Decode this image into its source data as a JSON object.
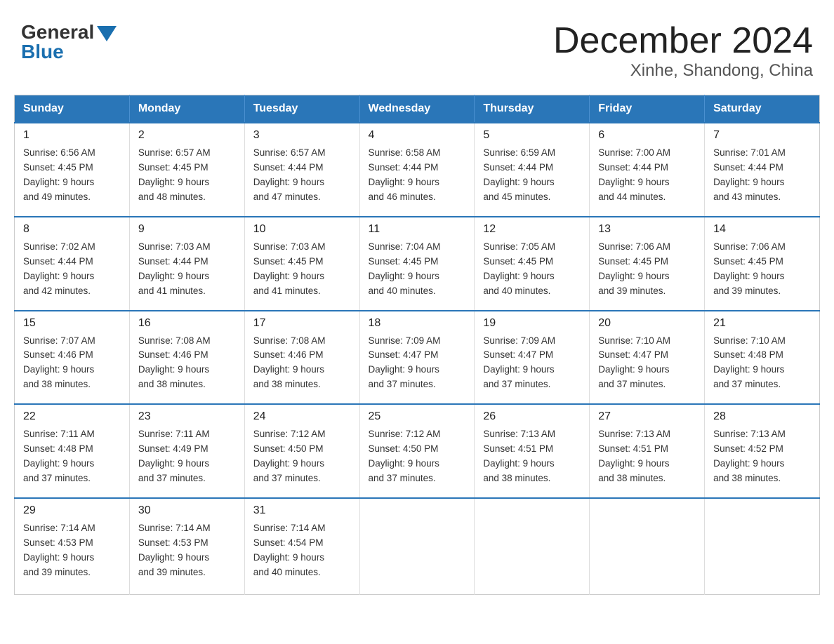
{
  "header": {
    "logo": {
      "general": "General",
      "blue": "Blue"
    },
    "title": "December 2024",
    "subtitle": "Xinhe, Shandong, China"
  },
  "days_of_week": [
    "Sunday",
    "Monday",
    "Tuesday",
    "Wednesday",
    "Thursday",
    "Friday",
    "Saturday"
  ],
  "weeks": [
    [
      {
        "day": "1",
        "sunrise": "Sunrise: 6:56 AM",
        "sunset": "Sunset: 4:45 PM",
        "daylight": "Daylight: 9 hours",
        "daylight2": "and 49 minutes."
      },
      {
        "day": "2",
        "sunrise": "Sunrise: 6:57 AM",
        "sunset": "Sunset: 4:45 PM",
        "daylight": "Daylight: 9 hours",
        "daylight2": "and 48 minutes."
      },
      {
        "day": "3",
        "sunrise": "Sunrise: 6:57 AM",
        "sunset": "Sunset: 4:44 PM",
        "daylight": "Daylight: 9 hours",
        "daylight2": "and 47 minutes."
      },
      {
        "day": "4",
        "sunrise": "Sunrise: 6:58 AM",
        "sunset": "Sunset: 4:44 PM",
        "daylight": "Daylight: 9 hours",
        "daylight2": "and 46 minutes."
      },
      {
        "day": "5",
        "sunrise": "Sunrise: 6:59 AM",
        "sunset": "Sunset: 4:44 PM",
        "daylight": "Daylight: 9 hours",
        "daylight2": "and 45 minutes."
      },
      {
        "day": "6",
        "sunrise": "Sunrise: 7:00 AM",
        "sunset": "Sunset: 4:44 PM",
        "daylight": "Daylight: 9 hours",
        "daylight2": "and 44 minutes."
      },
      {
        "day": "7",
        "sunrise": "Sunrise: 7:01 AM",
        "sunset": "Sunset: 4:44 PM",
        "daylight": "Daylight: 9 hours",
        "daylight2": "and 43 minutes."
      }
    ],
    [
      {
        "day": "8",
        "sunrise": "Sunrise: 7:02 AM",
        "sunset": "Sunset: 4:44 PM",
        "daylight": "Daylight: 9 hours",
        "daylight2": "and 42 minutes."
      },
      {
        "day": "9",
        "sunrise": "Sunrise: 7:03 AM",
        "sunset": "Sunset: 4:44 PM",
        "daylight": "Daylight: 9 hours",
        "daylight2": "and 41 minutes."
      },
      {
        "day": "10",
        "sunrise": "Sunrise: 7:03 AM",
        "sunset": "Sunset: 4:45 PM",
        "daylight": "Daylight: 9 hours",
        "daylight2": "and 41 minutes."
      },
      {
        "day": "11",
        "sunrise": "Sunrise: 7:04 AM",
        "sunset": "Sunset: 4:45 PM",
        "daylight": "Daylight: 9 hours",
        "daylight2": "and 40 minutes."
      },
      {
        "day": "12",
        "sunrise": "Sunrise: 7:05 AM",
        "sunset": "Sunset: 4:45 PM",
        "daylight": "Daylight: 9 hours",
        "daylight2": "and 40 minutes."
      },
      {
        "day": "13",
        "sunrise": "Sunrise: 7:06 AM",
        "sunset": "Sunset: 4:45 PM",
        "daylight": "Daylight: 9 hours",
        "daylight2": "and 39 minutes."
      },
      {
        "day": "14",
        "sunrise": "Sunrise: 7:06 AM",
        "sunset": "Sunset: 4:45 PM",
        "daylight": "Daylight: 9 hours",
        "daylight2": "and 39 minutes."
      }
    ],
    [
      {
        "day": "15",
        "sunrise": "Sunrise: 7:07 AM",
        "sunset": "Sunset: 4:46 PM",
        "daylight": "Daylight: 9 hours",
        "daylight2": "and 38 minutes."
      },
      {
        "day": "16",
        "sunrise": "Sunrise: 7:08 AM",
        "sunset": "Sunset: 4:46 PM",
        "daylight": "Daylight: 9 hours",
        "daylight2": "and 38 minutes."
      },
      {
        "day": "17",
        "sunrise": "Sunrise: 7:08 AM",
        "sunset": "Sunset: 4:46 PM",
        "daylight": "Daylight: 9 hours",
        "daylight2": "and 38 minutes."
      },
      {
        "day": "18",
        "sunrise": "Sunrise: 7:09 AM",
        "sunset": "Sunset: 4:47 PM",
        "daylight": "Daylight: 9 hours",
        "daylight2": "and 37 minutes."
      },
      {
        "day": "19",
        "sunrise": "Sunrise: 7:09 AM",
        "sunset": "Sunset: 4:47 PM",
        "daylight": "Daylight: 9 hours",
        "daylight2": "and 37 minutes."
      },
      {
        "day": "20",
        "sunrise": "Sunrise: 7:10 AM",
        "sunset": "Sunset: 4:47 PM",
        "daylight": "Daylight: 9 hours",
        "daylight2": "and 37 minutes."
      },
      {
        "day": "21",
        "sunrise": "Sunrise: 7:10 AM",
        "sunset": "Sunset: 4:48 PM",
        "daylight": "Daylight: 9 hours",
        "daylight2": "and 37 minutes."
      }
    ],
    [
      {
        "day": "22",
        "sunrise": "Sunrise: 7:11 AM",
        "sunset": "Sunset: 4:48 PM",
        "daylight": "Daylight: 9 hours",
        "daylight2": "and 37 minutes."
      },
      {
        "day": "23",
        "sunrise": "Sunrise: 7:11 AM",
        "sunset": "Sunset: 4:49 PM",
        "daylight": "Daylight: 9 hours",
        "daylight2": "and 37 minutes."
      },
      {
        "day": "24",
        "sunrise": "Sunrise: 7:12 AM",
        "sunset": "Sunset: 4:50 PM",
        "daylight": "Daylight: 9 hours",
        "daylight2": "and 37 minutes."
      },
      {
        "day": "25",
        "sunrise": "Sunrise: 7:12 AM",
        "sunset": "Sunset: 4:50 PM",
        "daylight": "Daylight: 9 hours",
        "daylight2": "and 37 minutes."
      },
      {
        "day": "26",
        "sunrise": "Sunrise: 7:13 AM",
        "sunset": "Sunset: 4:51 PM",
        "daylight": "Daylight: 9 hours",
        "daylight2": "and 38 minutes."
      },
      {
        "day": "27",
        "sunrise": "Sunrise: 7:13 AM",
        "sunset": "Sunset: 4:51 PM",
        "daylight": "Daylight: 9 hours",
        "daylight2": "and 38 minutes."
      },
      {
        "day": "28",
        "sunrise": "Sunrise: 7:13 AM",
        "sunset": "Sunset: 4:52 PM",
        "daylight": "Daylight: 9 hours",
        "daylight2": "and 38 minutes."
      }
    ],
    [
      {
        "day": "29",
        "sunrise": "Sunrise: 7:14 AM",
        "sunset": "Sunset: 4:53 PM",
        "daylight": "Daylight: 9 hours",
        "daylight2": "and 39 minutes."
      },
      {
        "day": "30",
        "sunrise": "Sunrise: 7:14 AM",
        "sunset": "Sunset: 4:53 PM",
        "daylight": "Daylight: 9 hours",
        "daylight2": "and 39 minutes."
      },
      {
        "day": "31",
        "sunrise": "Sunrise: 7:14 AM",
        "sunset": "Sunset: 4:54 PM",
        "daylight": "Daylight: 9 hours",
        "daylight2": "and 40 minutes."
      },
      null,
      null,
      null,
      null
    ]
  ]
}
